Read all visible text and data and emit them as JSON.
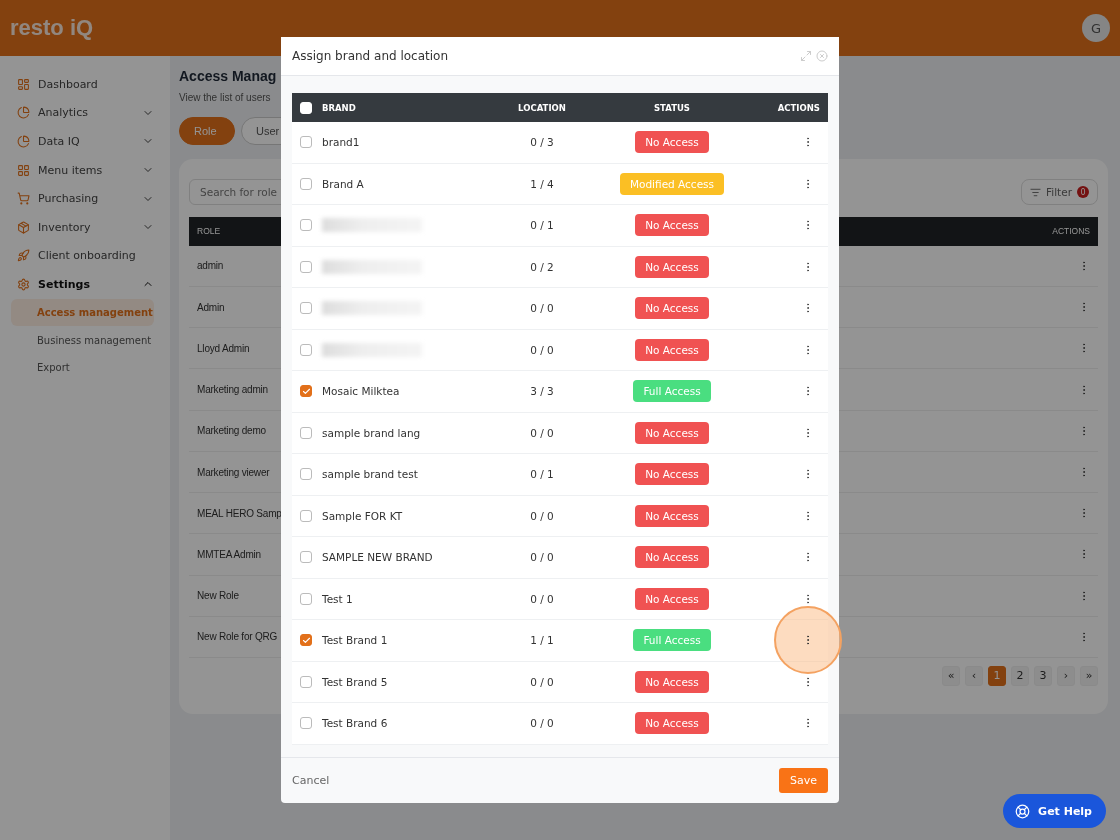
{
  "header": {
    "logo": "resto iQ",
    "avatar": "G"
  },
  "sidebar": {
    "items": [
      {
        "label": "Dashboard"
      },
      {
        "label": "Analytics",
        "expanded": false
      },
      {
        "label": "Data IQ",
        "expanded": false
      },
      {
        "label": "Menu items",
        "expanded": false
      },
      {
        "label": "Purchasing",
        "expanded": false
      },
      {
        "label": "Inventory",
        "expanded": false
      },
      {
        "label": "Client onboarding"
      },
      {
        "label": "Settings",
        "expanded": true,
        "children": [
          {
            "label": "Access management",
            "selected": true
          },
          {
            "label": "Business management",
            "selected": false
          },
          {
            "label": "Export",
            "selected": false
          }
        ]
      }
    ]
  },
  "page": {
    "title": "Access Manag",
    "subtitle": "View the list of users",
    "tabs": [
      {
        "label": "Role",
        "selected": true
      },
      {
        "label": "User",
        "selected": false
      }
    ],
    "search": {
      "placeholder": "Search for role"
    },
    "filter": {
      "label": "Filter",
      "count": "0"
    },
    "table": {
      "columns": [
        "ROLE",
        "ACTIONS"
      ],
      "rows": [
        "admin",
        "Admin",
        "Lloyd Admin",
        "Marketing admin",
        "Marketing demo",
        "Marketing viewer",
        "MEAL HERO Samp",
        "MMTEA Admin",
        "New Role",
        "New Role for QRG"
      ]
    },
    "pagination": [
      {
        "label": "«",
        "selected": false
      },
      {
        "label": "‹",
        "selected": false
      },
      {
        "label": "1",
        "selected": true
      },
      {
        "label": "2",
        "selected": false
      },
      {
        "label": "3",
        "selected": false
      },
      {
        "label": "›",
        "selected": false
      },
      {
        "label": "»",
        "selected": false
      }
    ]
  },
  "modal": {
    "title": "Assign brand and location",
    "columns": [
      "BRAND",
      "LOCATION",
      "STATUS",
      "ACTIONS"
    ],
    "select_all_checked": false,
    "rows": [
      {
        "kind": "text",
        "brand": "brand1",
        "checked": false,
        "location": "0 / 3",
        "status": {
          "kind": "none",
          "label": "No Access"
        },
        "highlighted": false
      },
      {
        "kind": "text",
        "brand": "Brand A",
        "checked": false,
        "location": "1 / 4",
        "status": {
          "kind": "modified",
          "label": "Modified Access"
        },
        "highlighted": false
      },
      {
        "kind": "redacted",
        "checked": false,
        "location": "0 / 1",
        "status": {
          "kind": "none",
          "label": "No Access"
        },
        "highlighted": false
      },
      {
        "kind": "redacted",
        "checked": false,
        "location": "0 / 2",
        "status": {
          "kind": "none",
          "label": "No Access"
        },
        "highlighted": false
      },
      {
        "kind": "redacted",
        "checked": false,
        "location": "0 / 0",
        "status": {
          "kind": "none",
          "label": "No Access"
        },
        "highlighted": false
      },
      {
        "kind": "redacted",
        "checked": false,
        "location": "0 / 0",
        "status": {
          "kind": "none",
          "label": "No Access"
        },
        "highlighted": false
      },
      {
        "kind": "text",
        "brand": "Mosaic Milktea",
        "checked": true,
        "location": "3 / 3",
        "status": {
          "kind": "full",
          "label": "Full Access"
        },
        "highlighted": false
      },
      {
        "kind": "text",
        "brand": "sample brand lang",
        "checked": false,
        "location": "0 / 0",
        "status": {
          "kind": "none",
          "label": "No Access"
        },
        "highlighted": false
      },
      {
        "kind": "text",
        "brand": "sample brand test",
        "checked": false,
        "location": "0 / 1",
        "status": {
          "kind": "none",
          "label": "No Access"
        },
        "highlighted": false
      },
      {
        "kind": "text",
        "brand": "Sample FOR KT",
        "checked": false,
        "location": "0 / 0",
        "status": {
          "kind": "none",
          "label": "No Access"
        },
        "highlighted": false
      },
      {
        "kind": "text",
        "brand": "SAMPLE NEW BRAND",
        "checked": false,
        "location": "0 / 0",
        "status": {
          "kind": "none",
          "label": "No Access"
        },
        "highlighted": false
      },
      {
        "kind": "text",
        "brand": "Test 1",
        "checked": false,
        "location": "0 / 0",
        "status": {
          "kind": "none",
          "label": "No Access"
        },
        "highlighted": false
      },
      {
        "kind": "text",
        "brand": "Test Brand 1",
        "checked": true,
        "location": "1 / 1",
        "status": {
          "kind": "full",
          "label": "Full Access"
        },
        "highlighted": true
      },
      {
        "kind": "text",
        "brand": "Test Brand 5",
        "checked": false,
        "location": "0 / 0",
        "status": {
          "kind": "none",
          "label": "No Access"
        },
        "highlighted": false
      },
      {
        "kind": "text",
        "brand": "Test Brand 6",
        "checked": false,
        "location": "0 / 0",
        "status": {
          "kind": "none",
          "label": "No Access"
        },
        "highlighted": false
      }
    ],
    "cancel": "Cancel",
    "save": "Save"
  },
  "help": {
    "label": "Get Help"
  }
}
